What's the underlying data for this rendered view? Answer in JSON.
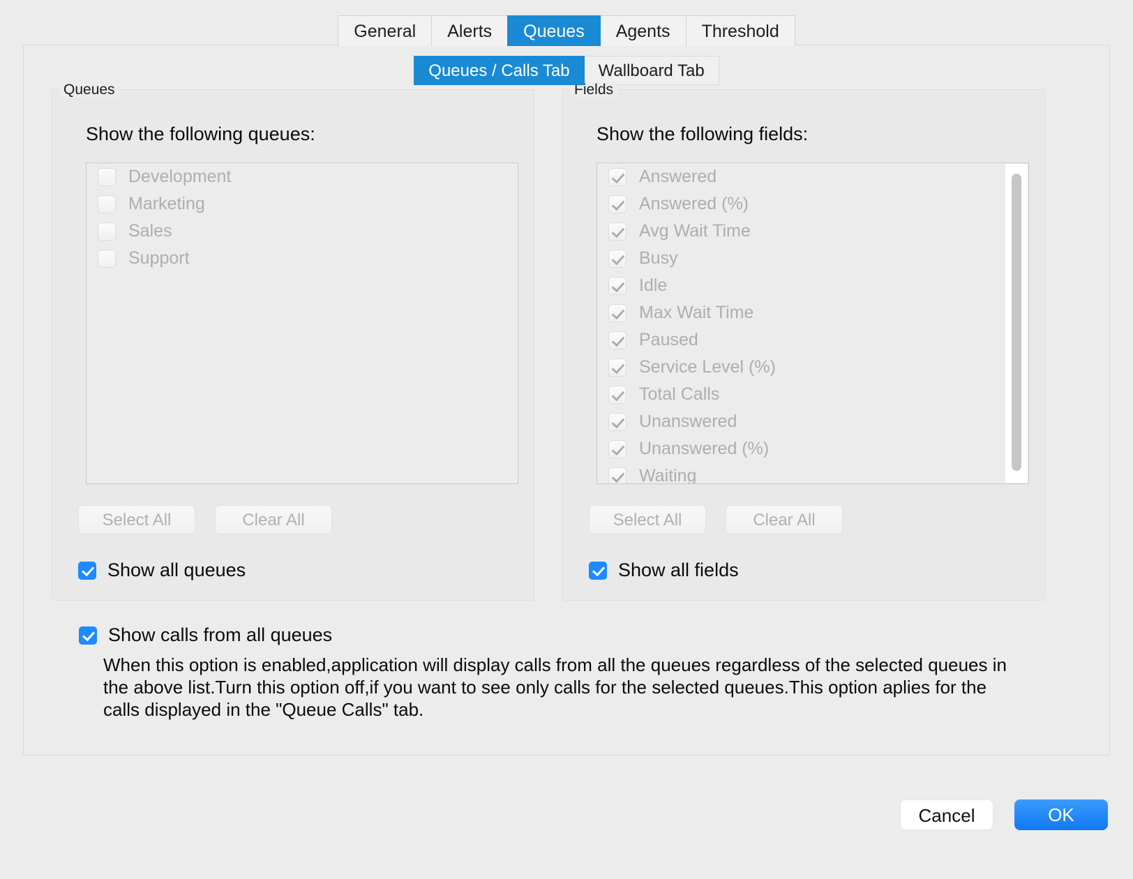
{
  "tabs": [
    {
      "label": "General",
      "active": false
    },
    {
      "label": "Alerts",
      "active": false
    },
    {
      "label": "Queues",
      "active": true
    },
    {
      "label": "Agents",
      "active": false
    },
    {
      "label": "Threshold",
      "active": false
    }
  ],
  "subtabs": [
    {
      "label": "Queues / Calls Tab",
      "active": true
    },
    {
      "label": "Wallboard Tab",
      "active": false
    }
  ],
  "queues_panel": {
    "legend": "Queues",
    "heading": "Show the following queues:",
    "items": [
      {
        "label": "Development",
        "checked": false
      },
      {
        "label": "Marketing",
        "checked": false
      },
      {
        "label": "Sales",
        "checked": false
      },
      {
        "label": "Support",
        "checked": false
      }
    ],
    "select_all": "Select All",
    "clear_all": "Clear All",
    "show_all": {
      "label": "Show all queues",
      "checked": true
    }
  },
  "fields_panel": {
    "legend": "Fields",
    "heading": "Show the following fields:",
    "items": [
      {
        "label": "Answered",
        "checked": true
      },
      {
        "label": "Answered (%)",
        "checked": true
      },
      {
        "label": "Avg Wait Time",
        "checked": true
      },
      {
        "label": "Busy",
        "checked": true
      },
      {
        "label": "Idle",
        "checked": true
      },
      {
        "label": "Max Wait Time",
        "checked": true
      },
      {
        "label": "Paused",
        "checked": true
      },
      {
        "label": "Service Level (%)",
        "checked": true
      },
      {
        "label": "Total Calls",
        "checked": true
      },
      {
        "label": "Unanswered",
        "checked": true
      },
      {
        "label": "Unanswered (%)",
        "checked": true
      },
      {
        "label": "Waiting",
        "checked": true
      }
    ],
    "select_all": "Select All",
    "clear_all": "Clear All",
    "show_all": {
      "label": "Show all fields",
      "checked": true
    }
  },
  "show_calls": {
    "label": "Show calls from all queues",
    "checked": true,
    "note": "When this option is enabled,application will display calls from all the queues regardless of the selected queues in the above list.Turn this option off,if you want to see only calls for the selected queues.This option aplies for the calls displayed in the \"Queue Calls\" tab."
  },
  "footer": {
    "cancel": "Cancel",
    "ok": "OK"
  },
  "colors": {
    "accent_blue": "#1a8ad4",
    "checkbox_blue": "#1d8aff",
    "ok_blue": "#0f79f2",
    "window_bg": "#ececec",
    "disabled_text": "#aeaeae"
  }
}
